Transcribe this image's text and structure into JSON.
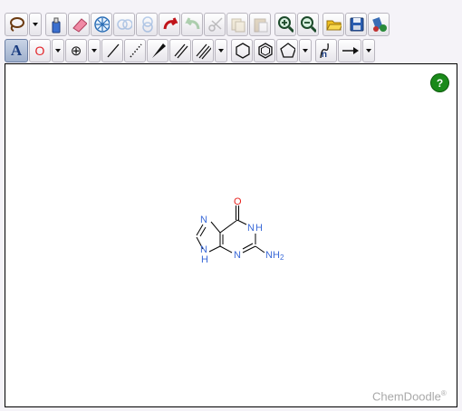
{
  "toolbar_row1": [
    {
      "name": "lasso-icon"
    },
    {
      "name": "lasso-dropdown"
    },
    {
      "name": "clear-icon"
    },
    {
      "name": "eraser-icon"
    },
    {
      "name": "center-icon"
    },
    {
      "name": "flip-horizontal-icon"
    },
    {
      "name": "flip-vertical-icon"
    },
    {
      "name": "undo-icon"
    },
    {
      "name": "redo-icon"
    },
    {
      "name": "cut-icon"
    },
    {
      "name": "copy-icon"
    },
    {
      "name": "paste-icon"
    },
    {
      "name": "zoom-in-icon"
    },
    {
      "name": "zoom-out-icon"
    },
    {
      "name": "open-folder-icon"
    },
    {
      "name": "save-icon"
    },
    {
      "name": "settings-icon"
    }
  ],
  "toolbar_row2": {
    "label_tool": "A",
    "element_label": "O",
    "charge_symbol": "⊕",
    "chain_label": "n"
  },
  "molecule": {
    "atoms": {
      "O": "O",
      "N1": "N",
      "N1H": "H",
      "N3": "N",
      "N7": "N",
      "N9": "N",
      "N9H": "H",
      "NH2": "NH",
      "NH2sub": "2"
    }
  },
  "help_label": "?",
  "brand": {
    "name": "ChemDoodle",
    "mark": "®"
  },
  "colors": {
    "nitrogen": "#3b6ad8",
    "oxygen": "#e8231f",
    "bond": "#000000",
    "help": "#1a8a1a"
  }
}
